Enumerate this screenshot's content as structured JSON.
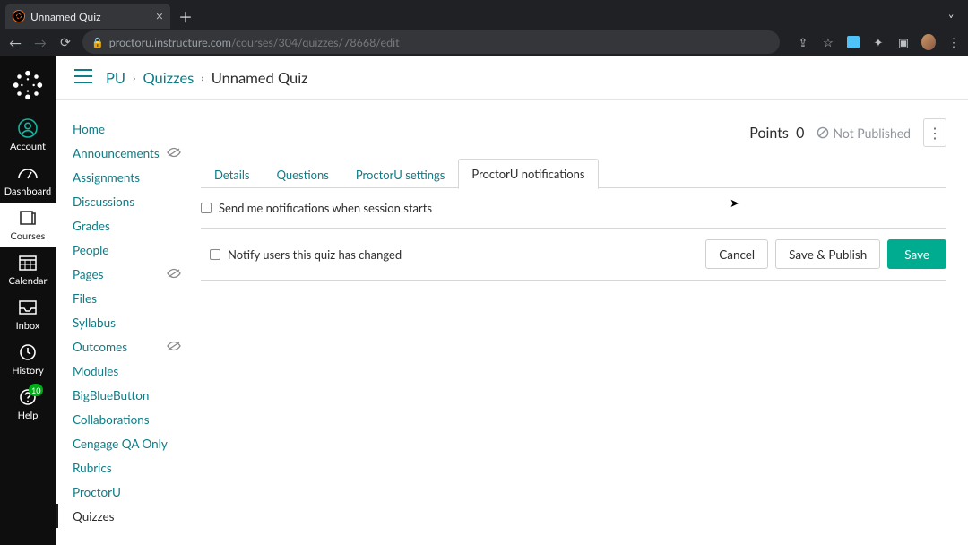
{
  "browser": {
    "tab_title": "Unnamed Quiz",
    "url_host": "proctoru.instructure.com",
    "url_path": "/courses/304/quizzes/78668/edit"
  },
  "global_nav": {
    "items": [
      {
        "label": "Account"
      },
      {
        "label": "Dashboard"
      },
      {
        "label": "Courses"
      },
      {
        "label": "Calendar"
      },
      {
        "label": "Inbox"
      },
      {
        "label": "History"
      },
      {
        "label": "Help",
        "badge": "10"
      }
    ]
  },
  "breadcrumbs": {
    "root": "PU",
    "section": "Quizzes",
    "current": "Unnamed Quiz"
  },
  "course_nav": {
    "items": [
      {
        "label": "Home"
      },
      {
        "label": "Announcements",
        "hidden": true
      },
      {
        "label": "Assignments"
      },
      {
        "label": "Discussions"
      },
      {
        "label": "Grades"
      },
      {
        "label": "People"
      },
      {
        "label": "Pages",
        "hidden": true
      },
      {
        "label": "Files"
      },
      {
        "label": "Syllabus"
      },
      {
        "label": "Outcomes",
        "hidden": true
      },
      {
        "label": "Modules"
      },
      {
        "label": "BigBlueButton"
      },
      {
        "label": "Collaborations"
      },
      {
        "label": "Cengage QA Only"
      },
      {
        "label": "Rubrics"
      },
      {
        "label": "ProctorU"
      },
      {
        "label": "Quizzes",
        "active": true
      }
    ]
  },
  "header": {
    "points_label": "Points",
    "points_value": "0",
    "publish_status": "Not Published"
  },
  "tabs": [
    {
      "label": "Details"
    },
    {
      "label": "Questions"
    },
    {
      "label": "ProctorU settings"
    },
    {
      "label": "ProctorU notifications",
      "active": true
    }
  ],
  "panel": {
    "send_notifications_label": "Send me notifications when session starts"
  },
  "footer": {
    "notify_changed_label": "Notify users this quiz has changed",
    "cancel": "Cancel",
    "save_publish": "Save & Publish",
    "save": "Save"
  }
}
